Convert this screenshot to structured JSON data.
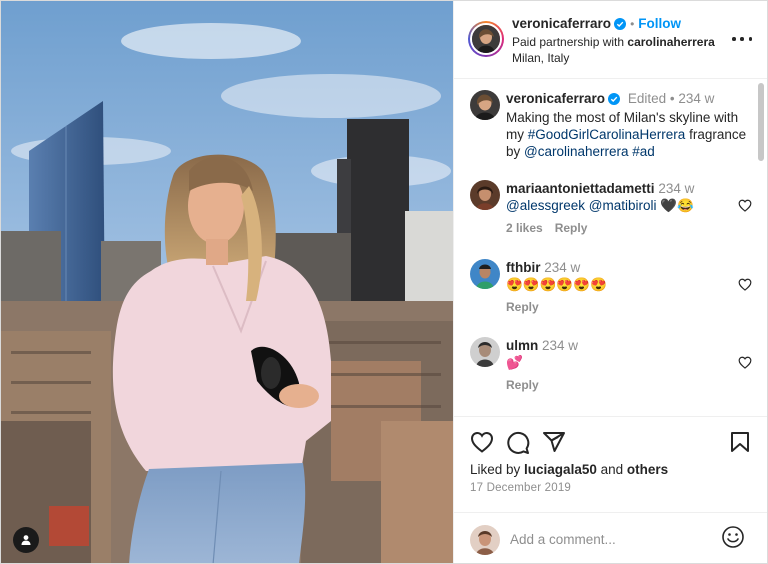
{
  "post": {
    "author": "veronicaferraro",
    "follow_label": "Follow",
    "partnership_prefix": "Paid partnership with ",
    "partner": "carolinaherrera",
    "location": "Milan, Italy",
    "accent": "#0095f6"
  },
  "caption": {
    "username": "veronicaferraro",
    "edited": "Edited",
    "time": "234 w",
    "text_1": "Making the most of Milan's skyline with my ",
    "hashtag_1": "#GoodGirlCarolinaHerrera",
    "text_2": " fragrance by ",
    "mention": "@carolinaherrera",
    "hashtag_2": "#ad"
  },
  "comments": [
    {
      "username": "mariaantoniettadametti",
      "time": "234 w",
      "mention_1": "@alessgreek",
      "mention_2": "@matibiroli",
      "emoji": "🖤😂",
      "likes": "2 likes",
      "reply": "Reply"
    },
    {
      "username": "fthbir",
      "time": "234 w",
      "text": "😍😍😍😍😍😍",
      "reply": "Reply"
    },
    {
      "username": "ulmn",
      "time": "234 w",
      "text": "💕",
      "reply": "Reply"
    }
  ],
  "footer": {
    "liked_by_prefix": "Liked by ",
    "liked_by_user": "luciagala50",
    "liked_by_mid": " and ",
    "liked_by_others": "others",
    "date": "17 December 2019",
    "comment_placeholder": "Add a comment..."
  },
  "icons": {
    "tag": "person-tag-icon",
    "like": "heart-icon",
    "comment": "comment-bubble-icon",
    "share": "paper-plane-icon",
    "save": "bookmark-icon",
    "emoji": "smiley-icon",
    "more": "more-options-icon",
    "verified": "verified-badge-icon"
  }
}
